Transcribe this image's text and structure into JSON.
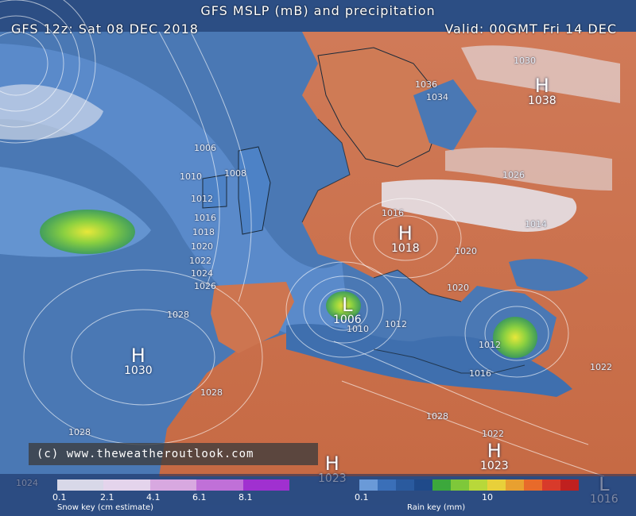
{
  "header": {
    "title": "GFS MSLP (mB) and precipitation",
    "run": "GFS 12z: Sat 08 DEC 2018",
    "valid": "Valid: 00GMT Fri 14 DEC"
  },
  "pressure_centres": [
    {
      "letter": "H",
      "value": "1030"
    },
    {
      "letter": "L",
      "value": "1006"
    },
    {
      "letter": "H",
      "value": "1018"
    },
    {
      "letter": "H",
      "value": "1023"
    },
    {
      "letter": "H",
      "value": "1023"
    },
    {
      "letter": "L",
      "value": "1016"
    },
    {
      "letter": "H",
      "value": "1038"
    }
  ],
  "isobar_labels": [
    "1006",
    "1008",
    "1010",
    "1012",
    "1016",
    "1018",
    "1020",
    "1022",
    "1024",
    "1026",
    "1028",
    "1028",
    "1028",
    "1028",
    "1010",
    "1012",
    "1012",
    "1016",
    "1016",
    "1020",
    "1020",
    "1022",
    "1022",
    "1024",
    "1026",
    "1030",
    "1034",
    "1036",
    "1014"
  ],
  "copyright": "(c)  www.theweatheroutlook.com",
  "snow_key": {
    "label": "Snow key (cm estimate)",
    "ticks": [
      "0.1",
      "2.1",
      "4.1",
      "6.1",
      "8.1"
    ],
    "colors": [
      "#d8d8e8",
      "#e4d4ec",
      "#d8a8e0",
      "#c070d8",
      "#a030d0"
    ]
  },
  "rain_key": {
    "label": "Rain key (mm)",
    "ticks": [
      "0.1",
      "10"
    ],
    "colors": [
      "#6a9ad8",
      "#3a6fb8",
      "#2a5a9e",
      "#1f4a8a",
      "#3ca83c",
      "#7ec83a",
      "#b8d83a",
      "#e8d03a",
      "#e8a030",
      "#e86a2a",
      "#d83a2a",
      "#c0201f"
    ]
  },
  "colors": {
    "sea": "#3e6fb0",
    "land": "#c9724f",
    "snow": "#e6e8f0"
  }
}
